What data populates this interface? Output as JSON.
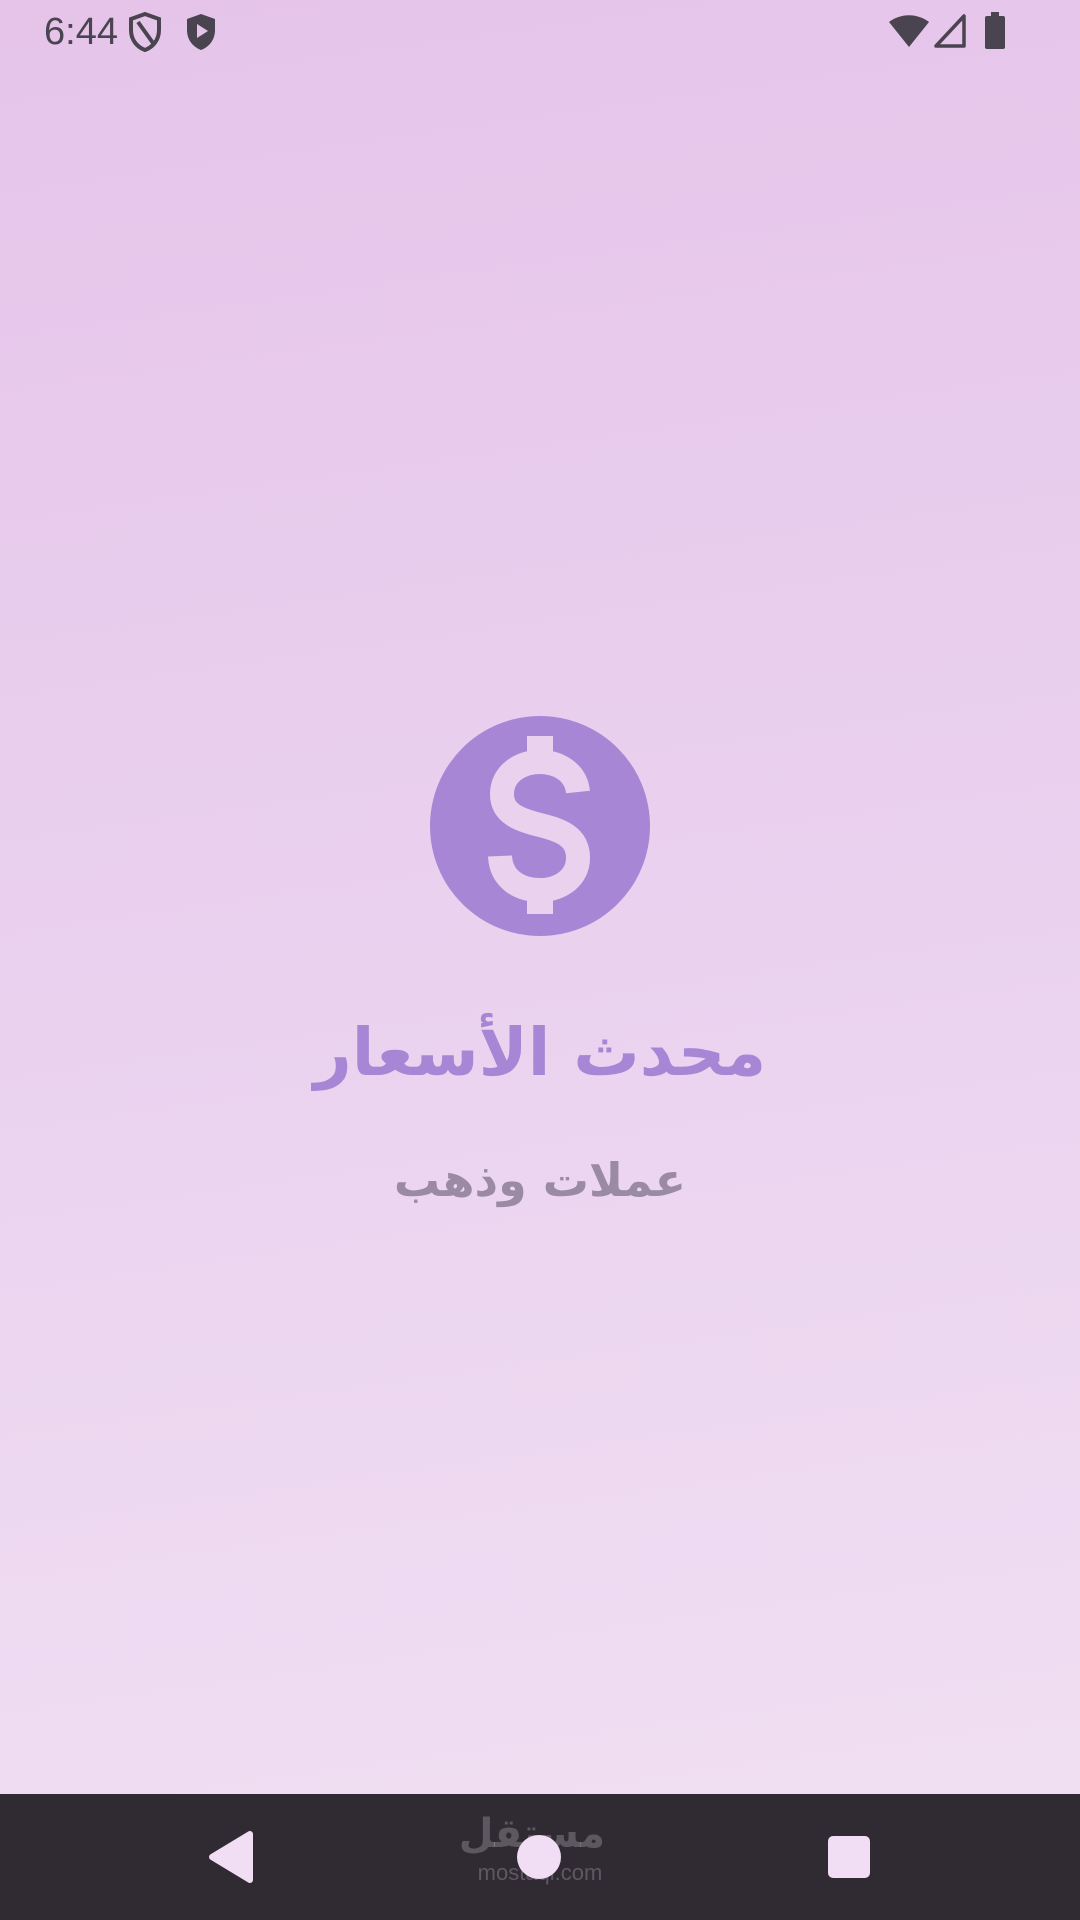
{
  "status_bar": {
    "time": "6:44",
    "left_icons": [
      "shield-outline-icon",
      "play-protect-shield-icon"
    ],
    "right_icons": [
      "wifi-icon",
      "cell-signal-icon",
      "battery-icon"
    ]
  },
  "splash": {
    "logo_icon": "dollar-coin-icon",
    "title": "محدث الأسعار",
    "subtitle": "عملات وذهب"
  },
  "nav_bar": {
    "buttons": [
      "back-icon",
      "home-icon",
      "recents-icon"
    ],
    "watermark": {
      "arabic": "مستقل",
      "latin": "mostaql.com"
    }
  },
  "colors": {
    "background_top": "#e6c4ea",
    "background_bottom": "#f1e0f3",
    "accent": "#a886d6",
    "subtitle": "#9b8aa3",
    "status_icons": "#4a4450",
    "nav_bar": "#302a33",
    "nav_buttons": "#f1ddf4"
  }
}
